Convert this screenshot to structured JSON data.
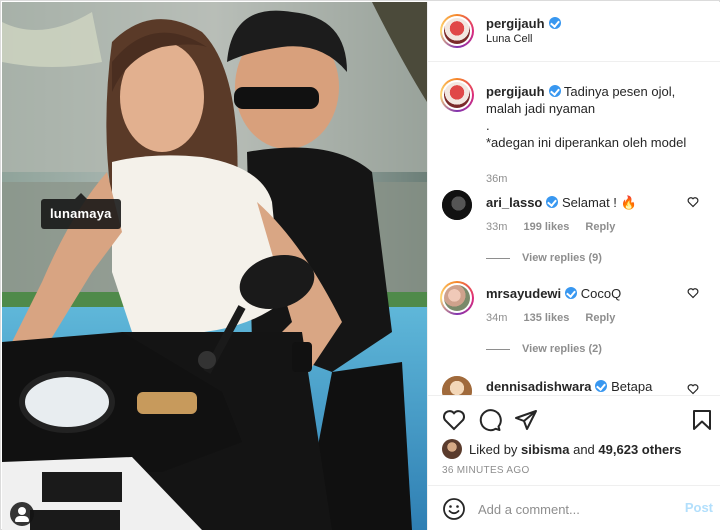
{
  "post": {
    "photo_tag": "lunamaya"
  },
  "header": {
    "username": "pergijauh",
    "location": "Luna Cell",
    "more_icon": "more-horizontal-icon"
  },
  "caption": {
    "username": "pergijauh",
    "text": "Tadinya pesen ojol,\nmalah jadi nyaman\n.\n*adegan ini diperankan oleh model",
    "time": "36m"
  },
  "comments": [
    {
      "username": "ari_lasso",
      "verified": true,
      "text": "Selamat ! 🔥",
      "time": "33m",
      "likes": "199 likes",
      "reply_label": "Reply",
      "view_replies": "View replies (9)"
    },
    {
      "username": "mrsayudewi",
      "verified": true,
      "text": "CocoQ",
      "time": "34m",
      "likes": "135 likes",
      "reply_label": "Reply",
      "view_replies": "View replies (2)"
    },
    {
      "username": "dennisadishwara",
      "verified": true,
      "text": "Betapa",
      "time": "",
      "likes": "",
      "reply_label": "",
      "view_replies": ""
    }
  ],
  "actions": {
    "like_icon": "heart-icon",
    "comment_icon": "comment-icon",
    "share_icon": "send-icon",
    "save_icon": "bookmark-icon",
    "liked_by_prefix": "Liked by",
    "liked_by_user": "sibisma",
    "liked_by_and": "and",
    "liked_by_count": "49,623 others",
    "timestamp": "36 MINUTES AGO"
  },
  "add_comment": {
    "placeholder": "Add a comment...",
    "post_label": "Post",
    "emoji_icon": "smiley-icon"
  },
  "colors": {
    "verified": "#3897f0",
    "muted": "#8e8e8e",
    "post_disabled": "#b2dffc",
    "border": "#efefef"
  }
}
